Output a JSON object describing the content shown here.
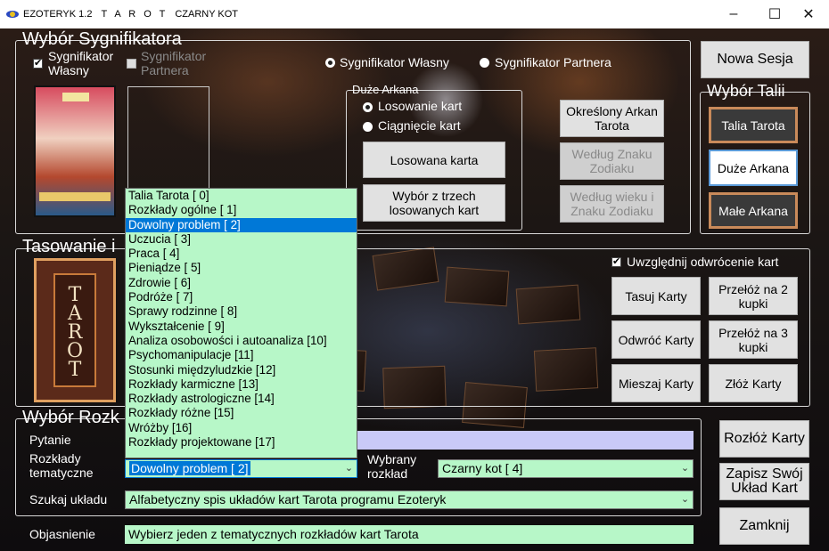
{
  "titlebar": {
    "app": "EZOTERYK 1.2",
    "tarot": "T A R O T",
    "subtitle": "CZARNY KOT",
    "min": "–",
    "max": "☐",
    "close": "✕"
  },
  "signifikator": {
    "group_title": "Wybór Sygnifikatora",
    "own_check_label": "Sygnifikator Własny",
    "partner_check_label": "Sygnifikator Partnera",
    "radio_own": "Sygnifikator Własny",
    "radio_partner": "Sygnifikator Partnera",
    "new_session": "Nowa Sesja",
    "major_group": "Duże Arkana",
    "radio_random": "Losowanie kart",
    "radio_pull": "Ciągnięcie kart",
    "btn_drawn": "Losowana karta",
    "btn_three": "Wybór z trzech losowanych kart",
    "btn_specific": "Określony Arkan Tarota",
    "btn_zodiac": "Według Znaku Zodiaku",
    "btn_age_zodiac": "Według wieku i Znaku Zodiaku"
  },
  "deck": {
    "group_title": "Wybór Talii",
    "tarot": "Talia Tarota",
    "major": "Duże Arkana",
    "minor": "Małe Arkana"
  },
  "shuffle": {
    "group_title": "Tasowanie i",
    "reversal_check": "Uwzględnij odwrócenie kart",
    "btn_shuffle": "Tasuj Karty",
    "btn_cut2": "Przełóż na 2 kupki",
    "btn_reverse": "Odwróć Karty",
    "btn_cut3": "Przełóż na 3 kupki",
    "btn_mix": "Mieszaj Karty",
    "btn_gather": "Złóż Karty",
    "card_back_text": "TAROT"
  },
  "layout": {
    "group_title": "Wybór Rozk",
    "question_label": "Pytanie",
    "thematic_label": "Rozkłady tematyczne",
    "thematic_value": "Dowolny problem [ 2]",
    "chosen_label": "Wybrany rozkład",
    "chosen_value": "Czarny kot [ 4]",
    "search_label": "Szukaj układu",
    "search_value": "Alfabetyczny spis układów kart Tarota programu Ezoteryk",
    "explain_label": "Objasnienie",
    "explain_value": "Wybierz jeden z tematycznych rozkładów kart Tarota",
    "btn_layout": "Rozłóż Karty",
    "btn_save": "Zapisz Swój Układ Kart",
    "btn_close": "Zamknij"
  },
  "dropdown_items": [
    "Talia Tarota [ 0]",
    "Rozkłady ogólne [ 1]",
    "Dowolny problem [ 2]",
    "Uczucia [ 3]",
    "Praca [ 4]",
    "Pieniądze [ 5]",
    "Zdrowie [ 6]",
    "Podróże [ 7]",
    "Sprawy rodzinne [ 8]",
    "Wykształcenie [ 9]",
    "Analiza osobowości i autoanaliza [10]",
    "Psychomanipulacje [11]",
    "Stosunki międzyludzkie [12]",
    "Rozkłady karmiczne [13]",
    "Rozkłady astrologiczne [14]",
    "Rozkłady różne [15]",
    "Wróżby  [16]",
    "Rozkłady projektowane [17]"
  ],
  "dropdown_selected_index": 2,
  "colors": {
    "field_bg": "#b7f7c8",
    "question_bg": "#c9c9f8",
    "selection": "#0078d7"
  }
}
